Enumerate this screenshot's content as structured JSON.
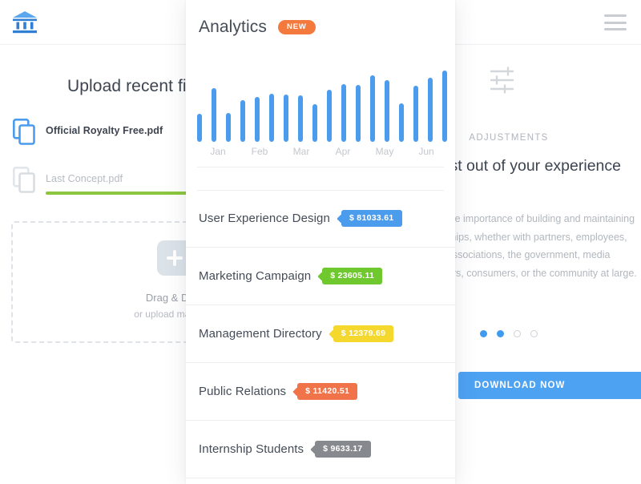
{
  "header": {
    "logo_icon": "bank-icon",
    "menu_icon": "hamburger-menu-icon"
  },
  "left_panel": {
    "title": "Upload recent files",
    "files": [
      {
        "name": "Official Royalty Free.pdf",
        "icon": "copy-files-icon",
        "state": "uploaded",
        "progress": 100
      },
      {
        "name": "Last Concept.pdf",
        "icon": "copy-files-icon",
        "state": "uploading",
        "progress": 100
      }
    ],
    "dropzone": {
      "plus_icon": "plus-icon",
      "title": "Drag & Drop",
      "subtitle": "or upload manually"
    },
    "colors": {
      "progress": "#8cc63e",
      "file_icon_active": "#4b9ced",
      "file_icon_muted": "#dfe2e6"
    }
  },
  "center_card": {
    "title": "Analytics",
    "badge": "NEW",
    "badge_color": "#f4793d",
    "chart_data": {
      "type": "bar",
      "title": "Analytics",
      "xlabel": "",
      "ylabel": "",
      "categories": [
        "Jan",
        "Feb",
        "Mar",
        "Apr",
        "May",
        "Jun"
      ],
      "tick_labels": [
        "Jan",
        "Feb",
        "Mar",
        "Apr",
        "May",
        "Jun"
      ],
      "bar_count": 18,
      "values": [
        33,
        64,
        34,
        50,
        53,
        57,
        56,
        55,
        45,
        62,
        69,
        68,
        79,
        73,
        46,
        67,
        76,
        85
      ],
      "ylim": [
        0,
        100
      ],
      "grid": false,
      "legend": "none",
      "bar_color": "#4b9ced"
    },
    "items": [
      {
        "label": "User Experience Design",
        "price": "$ 81033.61",
        "color": "#4b9ced"
      },
      {
        "label": "Marketing Campaign",
        "price": "$ 23605.11",
        "color": "#6fc92e"
      },
      {
        "label": "Management Directory",
        "price": "$ 12379.69",
        "color": "#f5d82e"
      },
      {
        "label": "Public Relations",
        "price": "$ 11420.51",
        "color": "#f0734a"
      },
      {
        "label": "Internship Students",
        "price": "$ 9633.17",
        "color": "#86898e"
      }
    ]
  },
  "right_panel": {
    "icon": "adjustments-sliders-icon",
    "eyebrow": "ADJUSTMENTS",
    "heading": "Get the most out of your experience",
    "body": "Most businesses know the importance of building and maintaining good working relationships, whether with partners, employees, business or trade associations, the government, media representatives, customers, consumers, or the community at large.",
    "dots": [
      true,
      true,
      false,
      false
    ],
    "cta_label": "DOWNLOAD NOW",
    "cta_color": "#4da2f1"
  }
}
